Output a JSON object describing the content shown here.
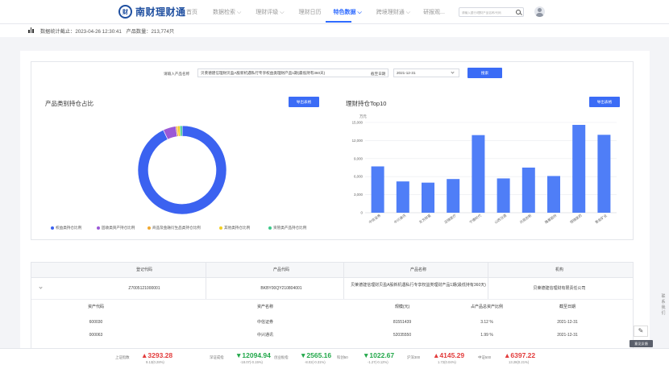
{
  "header": {
    "logo_glyph": "财",
    "logo_text": "南财理财通",
    "nav": [
      {
        "label": "首页"
      },
      {
        "label": "数据检索 ⌵"
      },
      {
        "label": "理财评级 ⌵"
      },
      {
        "label": "理财日历"
      },
      {
        "label": "特色数据 ⌵"
      },
      {
        "label": "跨境理财通 ⌵"
      },
      {
        "label": "研报观..."
      }
    ],
    "active_nav": "特色数据",
    "search_placeholder": "请输入银行/理财产品名称/代码"
  },
  "info": {
    "stat_time_label": "数据统计截止：",
    "stat_time": "2023-04-26 12:30:41",
    "product_count_label": "产品数量：",
    "product_count": "213,774只"
  },
  "filter": {
    "product_label": "请输入产品名称",
    "product_value": "贝莱德建信理财贝盈A股新机遇私行专享权益类理财产品1期(最低持有360天)",
    "date_label": "截至日期",
    "date_value": "2021-12-31",
    "search_button": "搜索"
  },
  "left_chart": {
    "title": "产品类别持仓占比",
    "export_button": "导出表格"
  },
  "right_chart": {
    "title": "理财持仓Top10",
    "export_button": "导出表格"
  },
  "chart_data": [
    {
      "type": "pie",
      "variant": "donut",
      "labels": [
        "权益类持仓比例",
        "固收类资产持仓比例",
        "商品及金融衍生品类持仓比例",
        "其他类持仓比例",
        "资管类产品持仓比例"
      ],
      "values": [
        93.0,
        4.7,
        0.6,
        0.9,
        0.8
      ],
      "colors": [
        "#3b62f0",
        "#9b59d6",
        "#f0a830",
        "#f2d024",
        "#3cc98a"
      ],
      "legend": "bottom"
    },
    {
      "type": "bar",
      "unit": "万元",
      "categories": [
        "中信证券",
        "中兴通讯",
        "东方财富",
        "迈瑞医疗",
        "宁德时代",
        "山西汾酒",
        "兆易创新",
        "隆基股份",
        "恒瑞医药",
        "紫金矿业"
      ],
      "values": [
        7700,
        5200,
        5000,
        5600,
        12900,
        5700,
        7500,
        6100,
        14600,
        12950
      ],
      "ylim": [
        0,
        15000
      ],
      "yticks": [
        "0",
        "3,000",
        "6,000",
        "9,000",
        "12,000",
        "15,000"
      ],
      "xticks": [
        "中信证券",
        "中兴通讯",
        "东方财富",
        "迈瑞医疗",
        "宁德时代",
        "山西汾酒",
        "兆易创新",
        "隆基股份",
        "恒瑞医药",
        "紫金矿业"
      ],
      "color": "#4f7ef7",
      "grid": true
    }
  ],
  "table": {
    "headers": [
      "登记代码",
      "产品代码",
      "产品名称",
      "机构"
    ],
    "row": {
      "register_code": "Z7005121000001",
      "product_code": "BKBY00QY210804001",
      "product_name": "贝莱德建信理财贝盈A股新机遇私行专享权益类理财产品1期(最低持有360天)",
      "institution": "贝莱德建信理财有限责任公司"
    },
    "sub_headers": [
      "资产代码",
      "资产名称",
      "规模(元)",
      "占产品总资产比例",
      "截至日期"
    ],
    "sub_rows": [
      [
        "600030",
        "中信证券",
        "81551439",
        "3.12 %",
        "2021-12-31"
      ],
      [
        "000063",
        "中兴通讯",
        "52035550",
        "1.99 %",
        "2021-12-31"
      ]
    ]
  },
  "ticker": [
    {
      "name": "上证指数",
      "value": "▲3293.28",
      "change": "9.13(0.28%)",
      "dir": "up"
    },
    {
      "name": "深证成指",
      "value": "▼12094.94",
      "change": "-18.07(-0.15%)",
      "dir": "down"
    },
    {
      "name": "创业板指",
      "value": "▼2565.16",
      "change": "-8.02(-0.31%)",
      "dir": "down"
    },
    {
      "name": "科创50",
      "value": "▼1022.67",
      "change": "-1.27(-0.12%)",
      "dir": "down"
    },
    {
      "name": "沪深300",
      "value": "▲4145.29",
      "change": "1.72(0.04%)",
      "dir": "up"
    },
    {
      "name": "中证500",
      "value": "▲6397.22",
      "change": "13.28(0.21%)",
      "dir": "up"
    }
  ],
  "side": {
    "label": "联系我们",
    "edit_icon": "✎",
    "feedback": "意见反馈"
  }
}
